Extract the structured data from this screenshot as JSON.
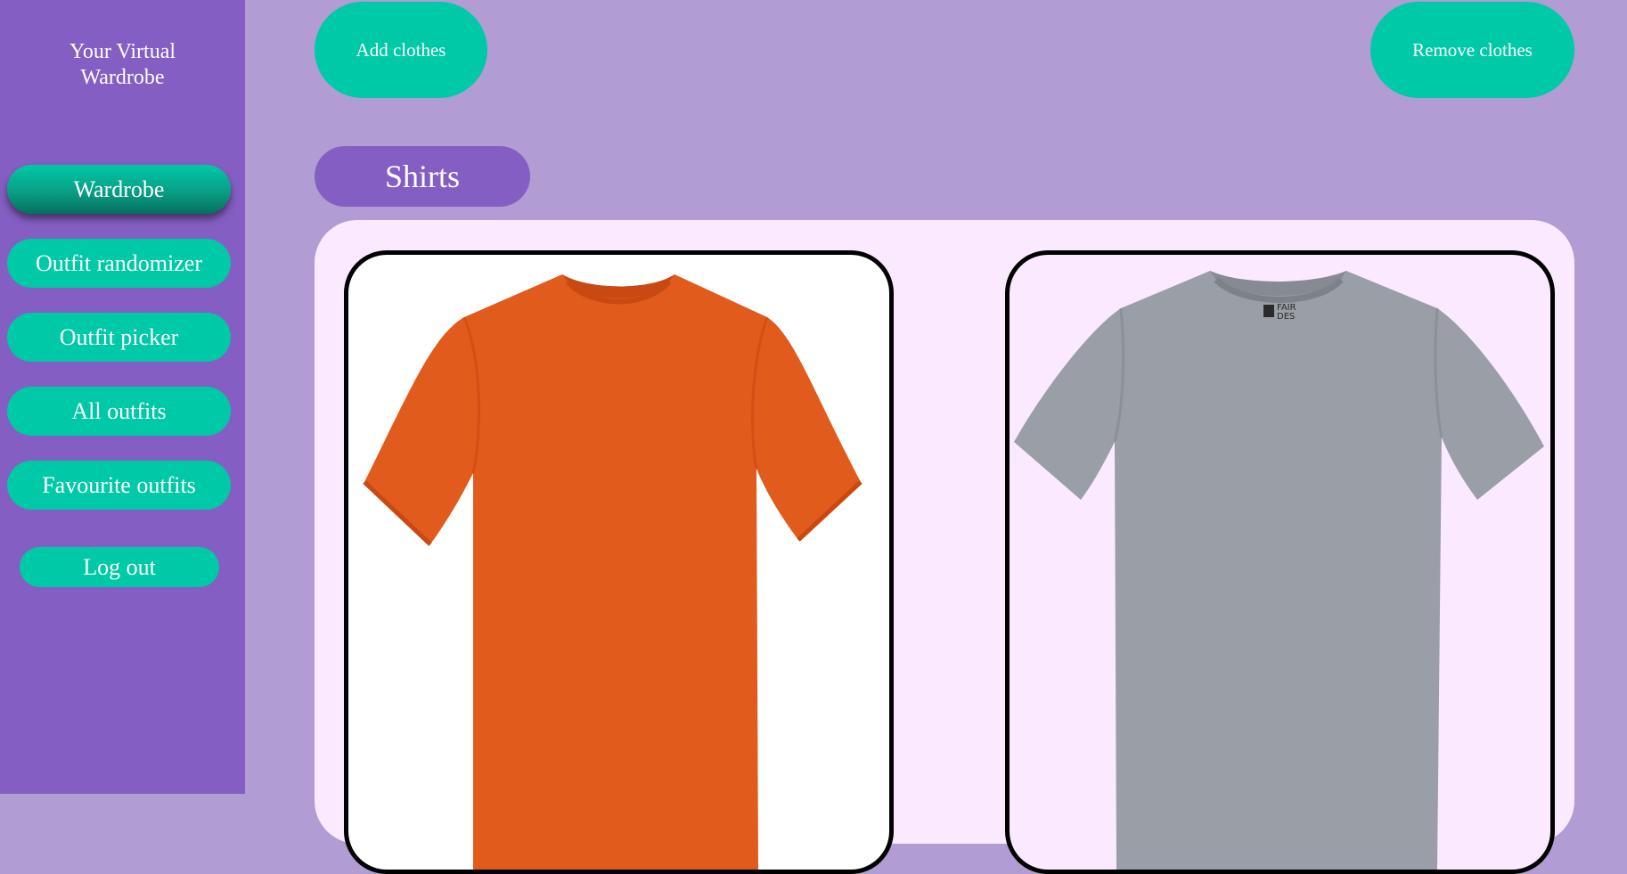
{
  "brand": {
    "line1": "Your Virtual",
    "line2": "Wardrobe"
  },
  "nav": {
    "items": [
      {
        "label": "Wardrobe",
        "active": true
      },
      {
        "label": "Outfit randomizer",
        "active": false
      },
      {
        "label": "Outfit picker",
        "active": false
      },
      {
        "label": "All outfits",
        "active": false
      },
      {
        "label": "Favourite outfits",
        "active": false
      }
    ],
    "logout_label": "Log out"
  },
  "toolbar": {
    "add_label": "Add clothes",
    "remove_label": "Remove clothes"
  },
  "category": {
    "label": "Shirts"
  },
  "clothes": [
    {
      "name": "orange-tshirt",
      "color": "#e15b1c"
    },
    {
      "name": "grey-tshirt",
      "color": "#9a9ea6",
      "print_text": "FAIR DES"
    }
  ],
  "colors": {
    "sidebar": "#845ec2",
    "background": "#b19cd3",
    "accent": "#00c9a7",
    "panel": "#fbeaff"
  }
}
